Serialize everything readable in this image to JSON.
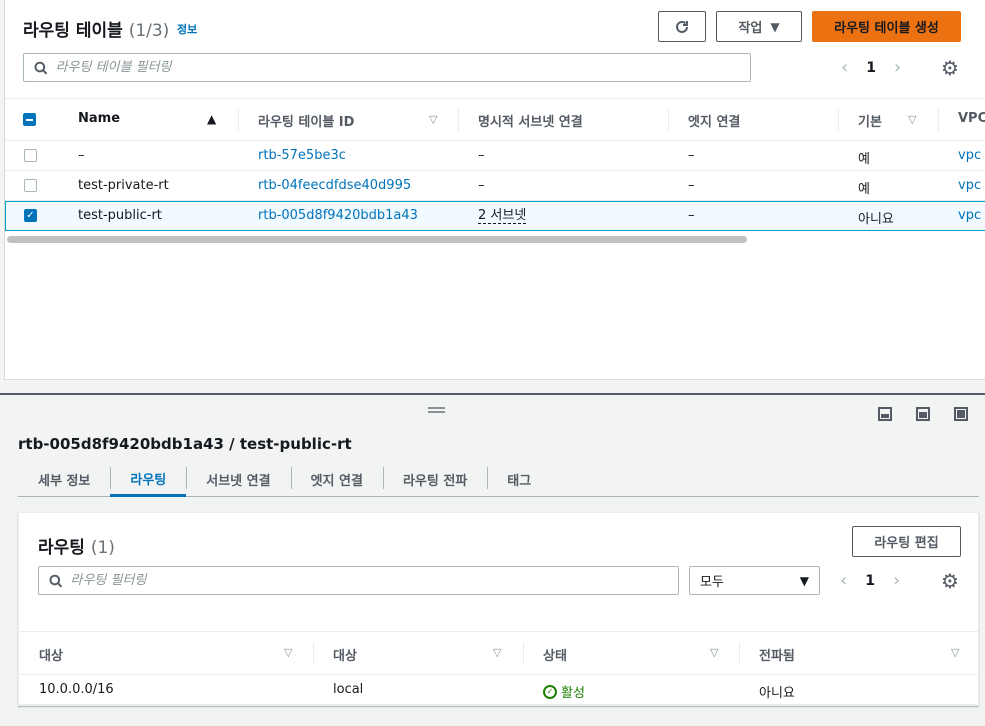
{
  "header": {
    "title": "라우팅 테이블",
    "count": "(1/3)",
    "info": "정보",
    "action_label": "작업",
    "create_label": "라우팅 테이블 생성",
    "search_placeholder": "라우팅 테이블 필터링",
    "page": "1"
  },
  "table": {
    "columns": [
      "Name",
      "라우팅 테이블 ID",
      "명시적 서브넷 연결",
      "엣지 연결",
      "기본",
      "VPC"
    ],
    "rows": [
      {
        "name": "–",
        "id": "rtb-57e5be3c",
        "subnet": "–",
        "edge": "–",
        "main": "예",
        "vpc": "vpc",
        "selected": false
      },
      {
        "name": "test-private-rt",
        "id": "rtb-04feecdfdse40d995",
        "subnet": "–",
        "edge": "–",
        "main": "예",
        "vpc": "vpc",
        "selected": false
      },
      {
        "name": "test-public-rt",
        "id": "rtb-005d8f9420bdb1a43",
        "subnet": "2 서브넷",
        "edge": "–",
        "main": "아니요",
        "vpc": "vpc",
        "selected": true
      }
    ]
  },
  "detail": {
    "title": "rtb-005d8f9420bdb1a43 / test-public-rt",
    "tabs": [
      "세부 정보",
      "라우팅",
      "서브넷 연결",
      "엣지 연결",
      "라우팅 전파",
      "태그"
    ],
    "active_tab": "라우팅"
  },
  "routes": {
    "title": "라우팅",
    "count": "(1)",
    "edit_label": "라우팅 편집",
    "search_placeholder": "라우팅 필터링",
    "select_value": "모두",
    "page": "1",
    "columns": [
      "대상",
      "대상",
      "상태",
      "전파됨"
    ],
    "rows": [
      {
        "destination": "10.0.0.0/16",
        "target": "local",
        "status": "활성",
        "propagated": "아니요"
      }
    ]
  },
  "colors": {
    "accent": "#0073bb",
    "primary_button": "#ec7211",
    "success": "#1d8102"
  }
}
